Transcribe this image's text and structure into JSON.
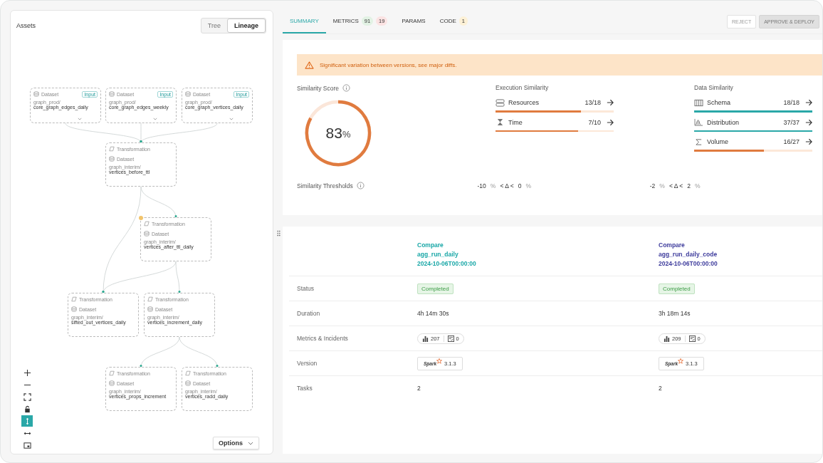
{
  "left_panel": {
    "title": "Assets",
    "view_toggle": [
      {
        "label": "Tree",
        "selected": false
      },
      {
        "label": "Lineage",
        "selected": true
      }
    ],
    "nodes": [
      {
        "kind": "dataset",
        "type_label": "Dataset",
        "badge": "Input",
        "path": "graph_prod/",
        "name": "core_graph_edges_daily",
        "flagged": false
      },
      {
        "kind": "dataset",
        "type_label": "Dataset",
        "badge": "Input",
        "path": "graph_prod/",
        "name": "core_graph_edges_weekly",
        "flagged": false
      },
      {
        "kind": "dataset",
        "type_label": "Dataset",
        "badge": "Input",
        "path": "graph_prod/",
        "name": "core_graph_vertices_daily",
        "flagged": false
      },
      {
        "kind": "transformation",
        "type_label": "Transformation",
        "sub_label": "Dataset",
        "path": "graph_interim/",
        "name": "vertices_before_ttl",
        "flagged": false
      },
      {
        "kind": "transformation",
        "type_label": "Transformation",
        "sub_label": "Dataset",
        "path": "graph_interim/",
        "name": "vertices_after_ttl_daily",
        "flagged": true
      },
      {
        "kind": "transformation",
        "type_label": "Transformation",
        "sub_label": "Dataset",
        "path": "graph_interim/",
        "name": "sifted_out_vertices_daily",
        "flagged": false
      },
      {
        "kind": "transformation",
        "type_label": "Transformation",
        "sub_label": "Dataset",
        "path": "graph_interim/",
        "name": "vertices_increment_daily",
        "flagged": false
      },
      {
        "kind": "transformation",
        "type_label": "Transformation",
        "sub_label": "Dataset",
        "path": "graph_interim/",
        "name": "vertices_props_increment",
        "flagged": false
      },
      {
        "kind": "transformation",
        "type_label": "Transformation",
        "sub_label": "Dataset",
        "path": "graph_interim/",
        "name": "vertices_radd_daily",
        "flagged": false
      }
    ],
    "zoom_tools": [
      {
        "kind": "zoom-in",
        "selected": false
      },
      {
        "kind": "zoom-out",
        "selected": false
      },
      {
        "kind": "fit",
        "selected": false
      },
      {
        "kind": "lock",
        "selected": false
      },
      {
        "kind": "vertical",
        "selected": true
      },
      {
        "kind": "horizontal",
        "selected": false
      },
      {
        "kind": "minimap",
        "selected": false
      }
    ],
    "options_button": "Options"
  },
  "tabs": [
    {
      "label": "SUMMARY",
      "selected": true
    },
    {
      "label": "METRICS",
      "selected": false,
      "badges": [
        {
          "text": "91",
          "color": "#e2f2e4"
        },
        {
          "text": "19",
          "color": "#fbe3e3"
        }
      ]
    },
    {
      "label": "PARAMS",
      "selected": false
    },
    {
      "label": "CODE",
      "selected": false,
      "badges": [
        {
          "text": "1",
          "color": "#fdf1d6"
        }
      ]
    }
  ],
  "actions": [
    {
      "label": "REJECT",
      "kind": "outline",
      "disabled": true
    },
    {
      "label": "APPROVE & DEPLOY",
      "kind": "filled",
      "disabled": true
    }
  ],
  "summary": {
    "alert": "Significant variation between versions, see major diffs.",
    "score": {
      "title": "Similarity Score",
      "value": "83",
      "unit": "%",
      "level": 0.83
    },
    "groups": [
      {
        "title": "Execution Similarity",
        "rows": [
          {
            "kind": "resources",
            "label": "Resources",
            "value": "13/18",
            "level": 0.72
          },
          {
            "kind": "time",
            "label": "Time",
            "value": "7/10",
            "level": 0.7
          }
        ]
      },
      {
        "title": "Data Similarity",
        "rows": [
          {
            "kind": "schema",
            "label": "Schema",
            "value": "18/18",
            "level": 1
          },
          {
            "kind": "distribution",
            "label": "Distribution",
            "value": "37/37",
            "level": 1
          },
          {
            "kind": "volume",
            "label": "Volume",
            "value": "16/27",
            "level": 0.59
          }
        ]
      }
    ],
    "thresholds": {
      "title": "Similarity Thresholds",
      "ranges": [
        {
          "low": "-10",
          "low_unit": "%",
          "operator": "< Δ <",
          "high": "0",
          "high_unit": "%"
        },
        {
          "low": "-2",
          "low_unit": "%",
          "operator": "< Δ <",
          "high": "2",
          "high_unit": "%"
        }
      ]
    }
  },
  "comparison": {
    "columns": [
      {
        "heading": "Compare",
        "name": "agg_run_daily",
        "date": "2024-10-06T00:00:00",
        "color": "#19a7a7"
      },
      {
        "heading": "Compare",
        "name": "agg_run_daily_code",
        "date": "2024-10-06T00:00:00",
        "color": "#3d3b9c"
      }
    ],
    "rows": [
      {
        "kind": "status",
        "label": "Status",
        "values": [
          {
            "text": "Completed"
          },
          {
            "text": "Completed"
          }
        ]
      },
      {
        "kind": "text",
        "label": "Duration",
        "values": [
          {
            "text": "4h 14m 30s"
          },
          {
            "text": "3h 18m 14s"
          }
        ]
      },
      {
        "kind": "metrics",
        "label": "Metrics & Incidents",
        "values": [
          {
            "metrics": "207",
            "incidents": "0"
          },
          {
            "metrics": "209",
            "incidents": "0"
          }
        ]
      },
      {
        "kind": "version",
        "label": "Version",
        "values": [
          {
            "logo": "Spark",
            "text": "3.1.3"
          },
          {
            "logo": "Spark",
            "text": "3.1.3"
          }
        ]
      },
      {
        "kind": "text",
        "label": "Tasks",
        "values": [
          {
            "text": "2"
          },
          {
            "text": "2"
          }
        ]
      }
    ]
  }
}
